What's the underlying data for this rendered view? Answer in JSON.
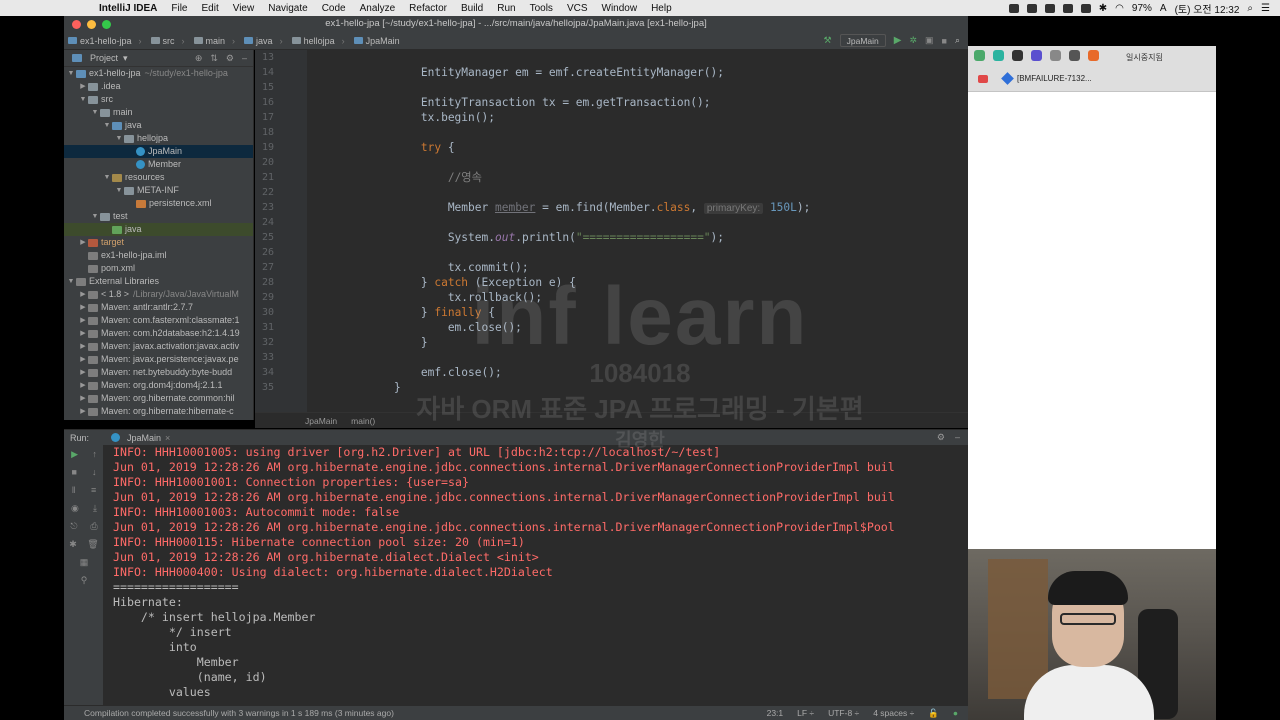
{
  "menubar": {
    "app": "IntelliJ IDEA",
    "items": [
      "File",
      "Edit",
      "View",
      "Navigate",
      "Code",
      "Analyze",
      "Refactor",
      "Build",
      "Run",
      "Tools",
      "VCS",
      "Window",
      "Help"
    ],
    "battery": "97%",
    "input": "A",
    "clock": "(토) 오전 12:32"
  },
  "window_title": "ex1-hello-jpa [~/study/ex1-hello-jpa] - .../src/main/java/hellojpa/JpaMain.java [ex1-hello-jpa]",
  "breadcrumbs": [
    "ex1-hello-jpa",
    "src",
    "main",
    "java",
    "hellojpa",
    "JpaMain"
  ],
  "run_config": "JpaMain",
  "project": {
    "header": "Project",
    "tree": [
      {
        "label": "ex1-hello-jpa",
        "extra": "~/study/ex1-hello-jpa",
        "depth": 0,
        "arrow": "▼",
        "icon": "src"
      },
      {
        "label": ".idea",
        "depth": 1,
        "arrow": "▶",
        "icon": "folder"
      },
      {
        "label": "src",
        "depth": 1,
        "arrow": "▼",
        "icon": "folder"
      },
      {
        "label": "main",
        "depth": 2,
        "arrow": "▼",
        "icon": "folder"
      },
      {
        "label": "java",
        "depth": 3,
        "arrow": "▼",
        "icon": "src"
      },
      {
        "label": "hellojpa",
        "depth": 4,
        "arrow": "▼",
        "icon": "folder"
      },
      {
        "label": "JpaMain",
        "depth": 5,
        "arrow": "",
        "icon": "cls",
        "selected": true
      },
      {
        "label": "Member",
        "depth": 5,
        "arrow": "",
        "icon": "cls"
      },
      {
        "label": "resources",
        "depth": 3,
        "arrow": "▼",
        "icon": "res"
      },
      {
        "label": "META-INF",
        "depth": 4,
        "arrow": "▼",
        "icon": "folder"
      },
      {
        "label": "persistence.xml",
        "depth": 5,
        "arrow": "",
        "icon": "xml"
      },
      {
        "label": "test",
        "depth": 2,
        "arrow": "▼",
        "icon": "folder"
      },
      {
        "label": "java",
        "depth": 3,
        "arrow": "",
        "icon": "test",
        "selected2": true
      },
      {
        "label": "target",
        "depth": 1,
        "arrow": "▶",
        "icon": "target",
        "target": true
      },
      {
        "label": "ex1-hello-jpa.iml",
        "depth": 1,
        "arrow": "",
        "icon": "lib"
      },
      {
        "label": "pom.xml",
        "depth": 1,
        "arrow": "",
        "icon": "lib"
      },
      {
        "label": "External Libraries",
        "depth": 0,
        "arrow": "▼",
        "icon": "lib"
      },
      {
        "label": "< 1.8 >",
        "extra": "/Library/Java/JavaVirtualM",
        "depth": 1,
        "arrow": "▶",
        "icon": "lib"
      },
      {
        "label": "Maven: antlr:antlr:2.7.7",
        "depth": 1,
        "arrow": "▶",
        "icon": "lib"
      },
      {
        "label": "Maven: com.fasterxml:classmate:1",
        "depth": 1,
        "arrow": "▶",
        "icon": "lib"
      },
      {
        "label": "Maven: com.h2database:h2:1.4.19",
        "depth": 1,
        "arrow": "▶",
        "icon": "lib"
      },
      {
        "label": "Maven: javax.activation:javax.activ",
        "depth": 1,
        "arrow": "▶",
        "icon": "lib"
      },
      {
        "label": "Maven: javax.persistence:javax.pe",
        "depth": 1,
        "arrow": "▶",
        "icon": "lib"
      },
      {
        "label": "Maven: net.bytebuddy:byte-budd",
        "depth": 1,
        "arrow": "▶",
        "icon": "lib"
      },
      {
        "label": "Maven: org.dom4j:dom4j:2.1.1",
        "depth": 1,
        "arrow": "▶",
        "icon": "lib"
      },
      {
        "label": "Maven: org.hibernate.common:hil",
        "depth": 1,
        "arrow": "▶",
        "icon": "lib"
      },
      {
        "label": "Maven: org.hibernate:hibernate-c",
        "depth": 1,
        "arrow": "▶",
        "icon": "lib"
      }
    ]
  },
  "editor": {
    "lines": [
      {
        "n": "13",
        "html": ""
      },
      {
        "n": "14",
        "html": "<span class='ind'>        </span>EntityManager em = emf.createEntityManager();"
      },
      {
        "n": "15",
        "html": ""
      },
      {
        "n": "16",
        "html": "        EntityTransaction tx = em.getTransaction();"
      },
      {
        "n": "17",
        "html": "        tx.begin();"
      },
      {
        "n": "18",
        "html": ""
      },
      {
        "n": "19",
        "html": "        <span class='kw'>try</span> {"
      },
      {
        "n": "20",
        "html": ""
      },
      {
        "n": "21",
        "html": "            <span class='cm'>//영속</span>"
      },
      {
        "n": "22",
        "html": ""
      },
      {
        "n": "23",
        "html": "            Member <span class='unused'>member</span> = em.find(Member.<span class='kw'>class</span>, <span class='hint'>primaryKey:</span> <span class='num'>150L</span>);"
      },
      {
        "n": "24",
        "html": ""
      },
      {
        "n": "25",
        "html": "            System.<span class='fld'>out</span>.println(<span class='str'>\"==================\"</span>);"
      },
      {
        "n": "26",
        "html": ""
      },
      {
        "n": "27",
        "html": "            tx.commit();"
      },
      {
        "n": "28",
        "html": "        } <span class='kw'>catch</span> (Exception e) {"
      },
      {
        "n": "29",
        "html": "            tx.rollback();"
      },
      {
        "n": "30",
        "html": "        } <span class='kw'>finally</span> {"
      },
      {
        "n": "31",
        "html": "            em.close();"
      },
      {
        "n": "32",
        "html": "        }"
      },
      {
        "n": "33",
        "html": ""
      },
      {
        "n": "34",
        "html": "        emf.close();"
      },
      {
        "n": "35",
        "html": "    }"
      }
    ],
    "footer": [
      "JpaMain",
      "main()"
    ]
  },
  "watermark": {
    "logo": "inf learn",
    "id": "1084018",
    "course": "자바 ORM 표준 JPA 프로그래밍 - 기본편",
    "author": "김영한"
  },
  "run": {
    "label": "Run:",
    "tab": "JpaMain",
    "console": [
      {
        "t": "err",
        "text": "INFO: HHH10001005: using driver [org.h2.Driver] at URL [jdbc:h2:tcp://localhost/~/test]"
      },
      {
        "t": "err",
        "text": "Jun 01, 2019 12:28:26 AM org.hibernate.engine.jdbc.connections.internal.DriverManagerConnectionProviderImpl buil"
      },
      {
        "t": "err",
        "text": "INFO: HHH10001001: Connection properties: {user=sa}"
      },
      {
        "t": "err",
        "text": "Jun 01, 2019 12:28:26 AM org.hibernate.engine.jdbc.connections.internal.DriverManagerConnectionProviderImpl buil"
      },
      {
        "t": "err",
        "text": "INFO: HHH10001003: Autocommit mode: false"
      },
      {
        "t": "err",
        "text": "Jun 01, 2019 12:28:26 AM org.hibernate.engine.jdbc.connections.internal.DriverManagerConnectionProviderImpl$Pool"
      },
      {
        "t": "err",
        "text": "INFO: HHH000115: Hibernate connection pool size: 20 (min=1)"
      },
      {
        "t": "err",
        "text": "Jun 01, 2019 12:28:26 AM org.hibernate.dialect.Dialect <init>"
      },
      {
        "t": "err",
        "text": "INFO: HHH000400: Using dialect: org.hibernate.dialect.H2Dialect"
      },
      {
        "t": "out",
        "text": "=================="
      },
      {
        "t": "out",
        "text": "Hibernate: "
      },
      {
        "t": "out",
        "text": "    /* insert hellojpa.Member"
      },
      {
        "t": "out",
        "text": "        */ insert "
      },
      {
        "t": "out",
        "text": "        into"
      },
      {
        "t": "out",
        "text": "            Member"
      },
      {
        "t": "out",
        "text": "            (name, id) "
      },
      {
        "t": "out",
        "text": "        values"
      }
    ]
  },
  "status": {
    "message": "Compilation completed successfully with 3 warnings in 1 s 189 ms (3 minutes ago)",
    "position": "23:1",
    "lf": "LF ÷",
    "encoding": "UTF-8 ÷",
    "indent": "4 spaces ÷"
  },
  "browser": {
    "profile": "일시중지됨",
    "bookmark": "[BMFAILURE-7132..."
  },
  "colors": {
    "editor_bg": "#2b2b2b",
    "keyword": "#cc7832",
    "string": "#6a8759",
    "error_text": "#ff6b68",
    "panel_bg": "#3c3f41"
  }
}
